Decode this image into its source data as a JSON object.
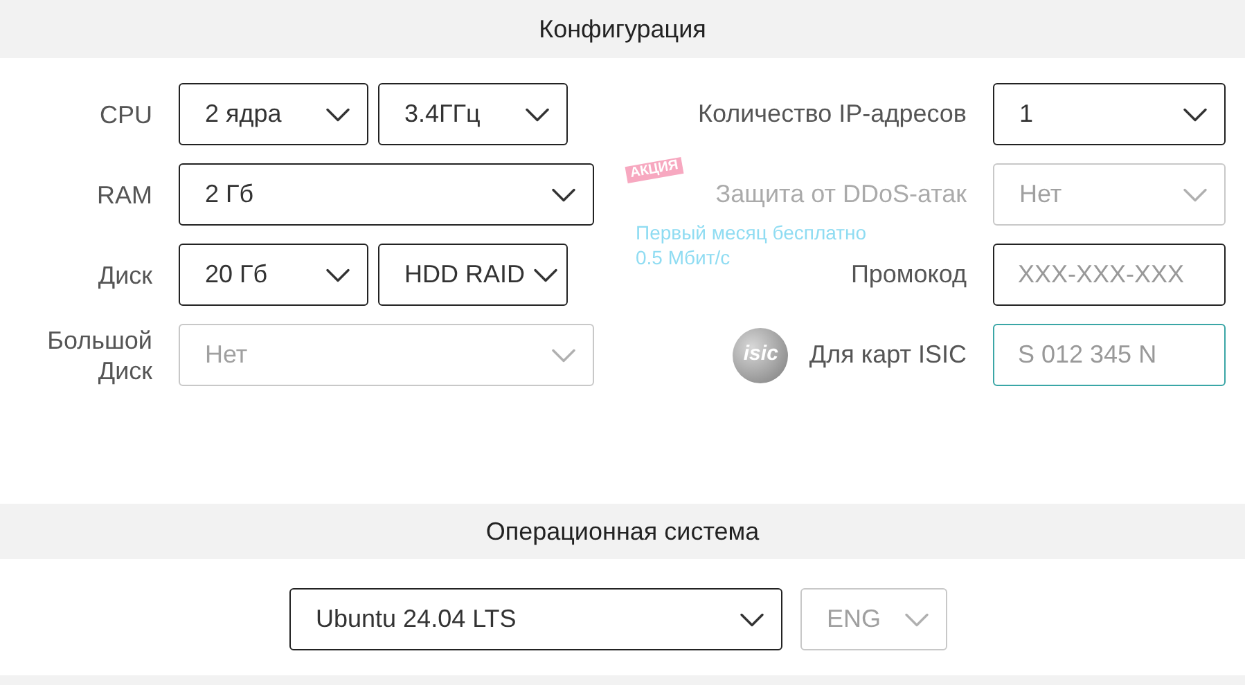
{
  "configuration": {
    "title": "Конфигурация",
    "left_rows": [
      {
        "label": "CPU",
        "controls": [
          {
            "kind": "select",
            "value": "2 ядра",
            "disabled": false
          },
          {
            "kind": "select",
            "value": "3.4ГГц",
            "disabled": false
          }
        ]
      },
      {
        "label": "RAM",
        "controls": [
          {
            "kind": "select",
            "value": "2 Гб",
            "disabled": false
          }
        ]
      },
      {
        "label": "Диск",
        "controls": [
          {
            "kind": "select",
            "value": "20 Гб",
            "disabled": false
          },
          {
            "kind": "select",
            "value": "HDD RAID",
            "disabled": false
          }
        ]
      },
      {
        "label": "Большой Диск",
        "controls": [
          {
            "kind": "select",
            "value": "Нет",
            "disabled": true
          }
        ]
      }
    ],
    "right_rows": [
      {
        "label": "Количество IP-адресов",
        "disabled": false,
        "control": {
          "kind": "select",
          "value": "1",
          "disabled": false
        }
      },
      {
        "label": "Защита от DDoS-атак",
        "disabled": true,
        "badge": "АКЦИЯ",
        "notes": [
          "Первый месяц бесплатно",
          "0.5 Мбит/с"
        ],
        "control": {
          "kind": "select",
          "value": "Нет",
          "disabled": true
        }
      },
      {
        "label": "Промокод",
        "disabled": false,
        "control": {
          "kind": "input",
          "placeholder": "XXX-XXX-XXX",
          "focused": false
        }
      },
      {
        "label": "Для карт ISIC",
        "disabled": false,
        "logo_text": "isic",
        "control": {
          "kind": "input",
          "placeholder": "S 012 345 N",
          "focused": true
        }
      }
    ]
  },
  "operating_system": {
    "title": "Операционная система",
    "controls": [
      {
        "kind": "select",
        "value": "Ubuntu 24.04 LTS",
        "disabled": false
      },
      {
        "kind": "select",
        "value": "ENG",
        "disabled": true
      }
    ]
  }
}
